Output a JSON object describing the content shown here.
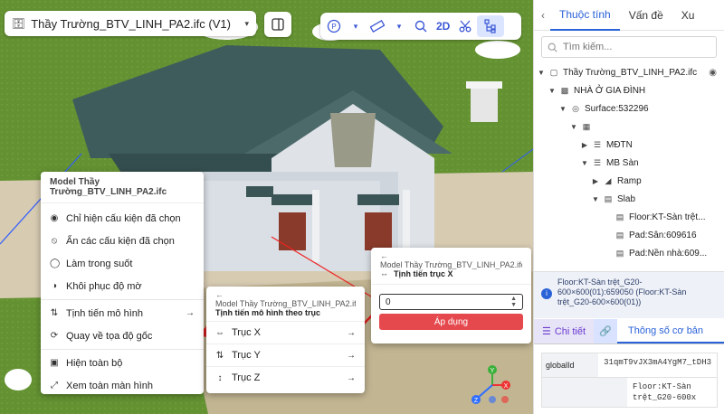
{
  "viewer": {
    "file_title": "Thầy Trường_BTV_LINH_PA2.ifc (V1)",
    "toolbar": {
      "label_2d": "2D"
    }
  },
  "context_menu": {
    "header": "Model Thầy Trường_BTV_LINH_PA2.ifc",
    "items": [
      {
        "label": "Chỉ hiện cấu kiện đã chọn"
      },
      {
        "label": "Ẩn các cấu kiện đã chọn"
      },
      {
        "label": "Làm trong suốt"
      },
      {
        "label": "Khôi phục độ mờ"
      },
      {
        "label": "Tịnh tiến mô hình"
      },
      {
        "label": "Quay về tọa độ gốc"
      },
      {
        "label": "Hiện toàn bộ"
      },
      {
        "label": "Xem toàn màn hình"
      }
    ]
  },
  "submenu": {
    "header_line1": "Model Thầy Trường_BTV_LINH_PA2.ifc",
    "header_line2": "Tịnh tiến mô hình theo trục",
    "items": [
      {
        "label": "Trục X"
      },
      {
        "label": "Trục Y"
      },
      {
        "label": "Trục Z"
      }
    ]
  },
  "translate_panel": {
    "header_line1": "Model Thầy Trường_BTV_LINH_PA2.ifc",
    "header_line2": "Tịnh tiến trục X",
    "value": "0",
    "apply_label": "Áp dụng"
  },
  "sidebar": {
    "tabs": [
      "Thuộc tính",
      "Vấn đề",
      "Xu"
    ],
    "search_placeholder": "Tìm kiếm...",
    "tree": [
      {
        "label": "Thầy Trường_BTV_LINH_PA2.ifc"
      },
      {
        "label": "NHÀ Ở GIA ĐÌNH"
      },
      {
        "label": "Surface:532296"
      },
      {
        "label": ""
      },
      {
        "label": "MĐTN"
      },
      {
        "label": "MB Sàn"
      },
      {
        "label": "Ramp"
      },
      {
        "label": "Slab"
      },
      {
        "label": "Floor:KT-Sàn trệt..."
      },
      {
        "label": "Pad:Sân:609616"
      },
      {
        "label": "Pad:Nền nhà:609..."
      }
    ],
    "selected_info": "Floor:KT-Sàn trệt_G20-600×600(01):659050 (Floor:KT-Sàn trệt_G20-600×600(01))",
    "detail_tabs": {
      "detail": "Chi tiết",
      "basic": "Thông số cơ bản"
    },
    "properties": [
      {
        "key": "globalId",
        "value": "31qmT9vJX3mA4YgM7_tDH3"
      },
      {
        "key": "",
        "value": "Floor:KT-Sàn trệt_G20-600x"
      }
    ]
  },
  "colors": {
    "accent": "#2a62d8",
    "apply_button": "#e5484d",
    "roof": "#3e5a5b",
    "wall": "#d8dde2"
  }
}
